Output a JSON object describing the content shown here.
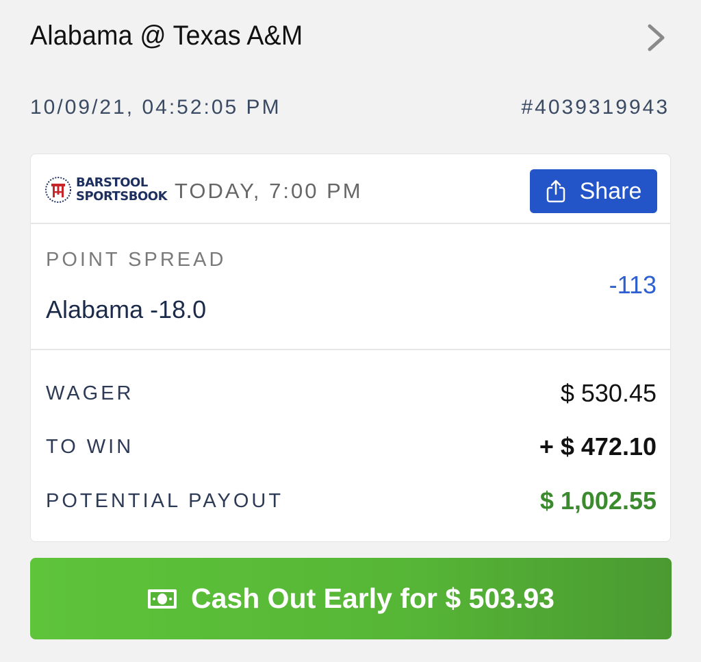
{
  "header": {
    "title": "Alabama @ Texas A&M"
  },
  "bet_meta": {
    "placed_at": "10/09/21, 04:52:05 PM",
    "bet_id": "#4039319943"
  },
  "card": {
    "logo_line1": "BARSTOOL",
    "logo_line2": "SPORTSBOOK",
    "event_time": "TODAY, 7:00 PM",
    "share_label": "Share",
    "market_type": "POINT SPREAD",
    "selection": "Alabama -18.0",
    "odds": "-113",
    "wager_label": "WAGER",
    "wager_value": "$ 530.45",
    "to_win_label": "TO WIN",
    "to_win_value": "+ $ 472.10",
    "payout_label": "POTENTIAL PAYOUT",
    "payout_value": "$ 1,002.55"
  },
  "cashout": {
    "label": "Cash Out Early for $ 503.93"
  },
  "colors": {
    "share_blue": "#2354c8",
    "odds_blue": "#2d5fd0",
    "payout_green": "#3c8a2e",
    "cashout_green": "#56b536"
  },
  "icons": {
    "chevron": "chevron-right-icon",
    "logo": "barstool-logo-icon",
    "share": "share-icon",
    "cash": "cash-icon"
  }
}
